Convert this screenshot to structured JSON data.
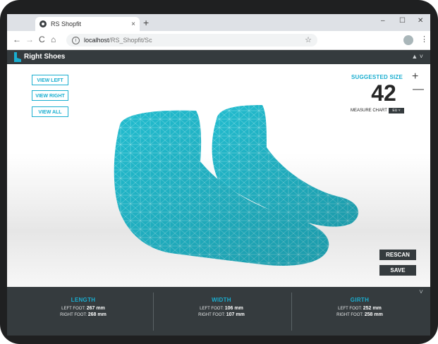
{
  "browser": {
    "tab_title": "RS Shopfit",
    "tab_close": "×",
    "new_tab": "+",
    "minimize": "–",
    "maximize": "☐",
    "close": "✕",
    "back": "←",
    "forward": "→",
    "reload": "C",
    "home": "⌂",
    "url_host": "localhost",
    "url_path": "/RS_Shopfit/Sc",
    "star": "☆",
    "menu": "⋮"
  },
  "app": {
    "brand": "Right Shoes",
    "user_menu": "▲ ˅",
    "accent": "#1aaed0",
    "dark": "#353b3e",
    "model_color": "#22bccf"
  },
  "view_buttons": [
    "VIEW LEFT",
    "VIEW RIGHT",
    "VIEW ALL"
  ],
  "suggested": {
    "label": "SUGGESTED SIZE",
    "value": "42",
    "zoom_in": "+",
    "zoom_out": "—",
    "chart_label": "MEASURE CHART",
    "chart_system": "EU ˅"
  },
  "actions": {
    "rescan": "RESCAN",
    "save": "SAVE"
  },
  "measurements": {
    "collapse_icon": "˅",
    "columns": [
      {
        "title": "LENGTH",
        "left_label": "LEFT FOOT:",
        "left_value": "267 mm",
        "right_label": "RIGHT FOOT:",
        "right_value": "268 mm"
      },
      {
        "title": "WIDTH",
        "left_label": "LEFT FOOT:",
        "left_value": "106 mm",
        "right_label": "RIGHT FOOT:",
        "right_value": "107 mm"
      },
      {
        "title": "GIRTH",
        "left_label": "LEFT FOOT:",
        "left_value": "252 mm",
        "right_label": "RIGHT FOOT:",
        "right_value": "258 mm"
      }
    ]
  }
}
